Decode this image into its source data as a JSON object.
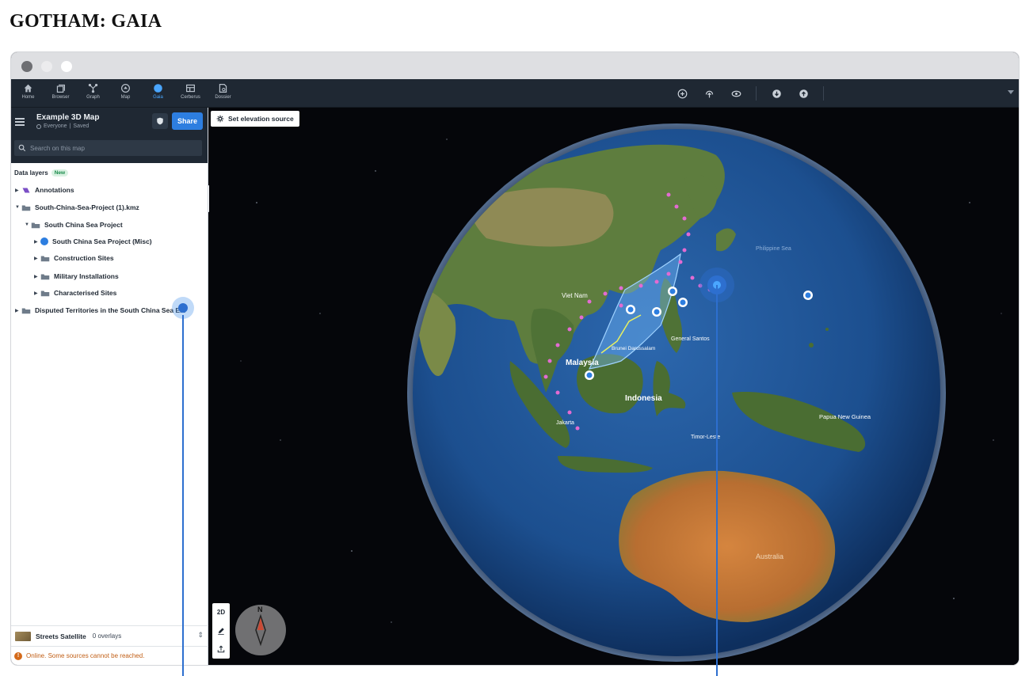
{
  "page": {
    "title": "GOTHAM: GAIA"
  },
  "nav": [
    {
      "label": "Home",
      "icon": "home-icon"
    },
    {
      "label": "Browser",
      "icon": "browser-icon"
    },
    {
      "label": "Graph",
      "icon": "graph-icon"
    },
    {
      "label": "Map",
      "icon": "map-icon"
    },
    {
      "label": "Gaia",
      "icon": "gaia-icon"
    },
    {
      "label": "Cerberus",
      "icon": "cerberus-icon"
    },
    {
      "label": "Dossier",
      "icon": "dossier-icon"
    }
  ],
  "active_nav": "Gaia",
  "sidebar": {
    "map_title": "Example 3D Map",
    "visibility": "Everyone",
    "save_state": "Saved",
    "share_label": "Share",
    "search_placeholder": "Search on this map",
    "data_layers_label": "Data layers",
    "new_badge": "New",
    "layers": [
      {
        "label": "Annotations"
      },
      {
        "label": "South-China-Sea-Project (1).kmz"
      },
      {
        "label": "South China Sea Project"
      },
      {
        "label": "South China Sea Project (Misc)"
      },
      {
        "label": "Construction Sites"
      },
      {
        "label": "Military Installations"
      },
      {
        "label": "Characterised Sites"
      },
      {
        "label": "Disputed Territories in the South China Sea E..."
      }
    ],
    "basemap_name": "Streets Satellite",
    "overlays": "0 overlays",
    "status": "Online. Some sources cannot be reached."
  },
  "map": {
    "elevation_button": "Set elevation source",
    "view_2d": "2D",
    "compass_label": "N",
    "place_labels": [
      "Viet Nam",
      "Malaysia",
      "Indonesia",
      "Brunei Darussalam",
      "General Santos",
      "Papua New Guinea",
      "Timor-Leste",
      "Jakarta",
      "Philippine Sea",
      "Australia"
    ]
  },
  "colors": {
    "accent": "#2d7ee0",
    "appbar": "#1f2833",
    "ocean": "#1c4f8f",
    "land": "#5e7d3e",
    "desert": "#c3783b",
    "status_warning": "#d46a1a"
  }
}
